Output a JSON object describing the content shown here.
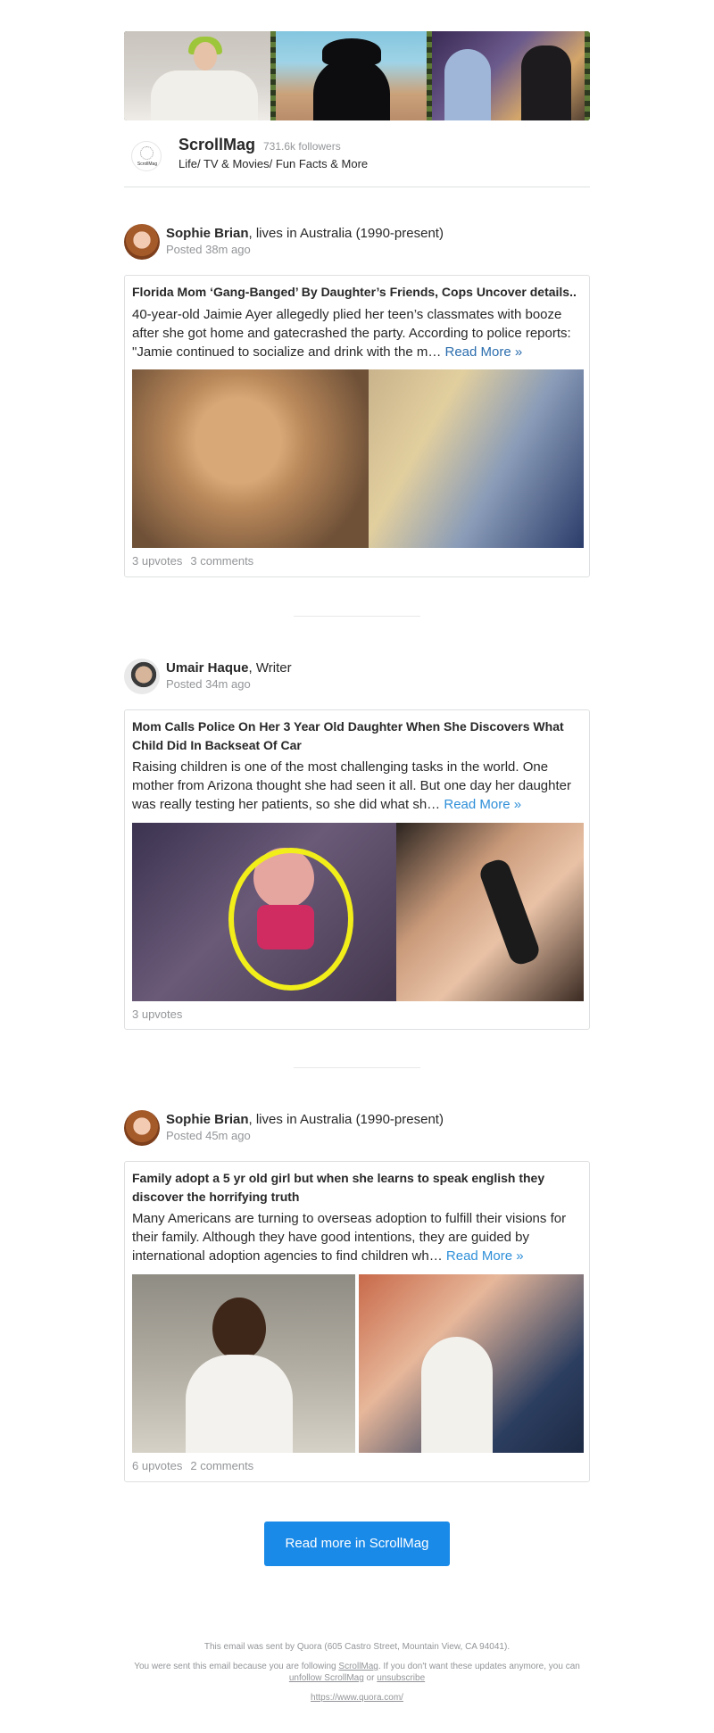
{
  "space": {
    "name": "ScrollMag",
    "followers": "731.6k followers",
    "description": "Life/ TV & Movies/ Fun Facts & More",
    "logo_text": "ScrollMag"
  },
  "posts": [
    {
      "author_name": "Sophie Brian",
      "author_credential": ", lives in Australia (1990-present)",
      "posted": "Posted 38m ago",
      "title": "Florida Mom ‘Gang-Banged’ By Daughter’s Friends, Cops Uncover details..",
      "body": "40-year-old Jaimie Ayer allegedly plied her teen’s classmates with booze after she got home and gatecrashed the party. According to police reports: \"Jamie continued to socialize and drink with the m…",
      "read_more": "Read More »",
      "upvotes": "3 upvotes",
      "comments": "3 comments"
    },
    {
      "author_name": "Umair Haque",
      "author_credential": ", Writer",
      "posted": "Posted 34m ago",
      "title": "Mom Calls Police On Her 3 Year Old Daughter When She Discovers What Child Did In Backseat Of Car",
      "body": "Raising children is one of the most challenging tasks in the world. One mother from Arizona thought she had seen it all. But one day her daughter was really testing her patients, so she did what sh…",
      "read_more": "Read More »",
      "upvotes": "3 upvotes"
    },
    {
      "author_name": "Sophie Brian",
      "author_credential": ", lives in Australia (1990-present)",
      "posted": "Posted 45m ago",
      "title": "Family adopt a 5 yr old girl but when she learns to speak english they discover the horrifying truth",
      "body": "Many Americans are turning to overseas adoption to fulfill their visions for their family. Although they have good intentions, they are guided by international adoption agencies to find children wh…",
      "read_more": "Read More »",
      "upvotes": "6 upvotes",
      "comments": "2 comments"
    }
  ],
  "cta_label": "Read more in ScrollMag",
  "footer": {
    "line1": "This email was sent by Quora (605 Castro Street, Mountain View, CA 94041).",
    "line2_a": "You were sent this email because you are following ",
    "line2_link1": "ScrollMag",
    "line2_b": ". If you don't want these updates anymore, you can ",
    "line2_link2": "unfollow ScrollMag",
    "line2_c": " or ",
    "line2_link3": "unsubscribe",
    "link": "https://www.quora.com/"
  },
  "colors": {
    "accent": "#1a8ae8",
    "link": "#2b6dad",
    "muted": "#939598",
    "border": "#dee0e1"
  }
}
